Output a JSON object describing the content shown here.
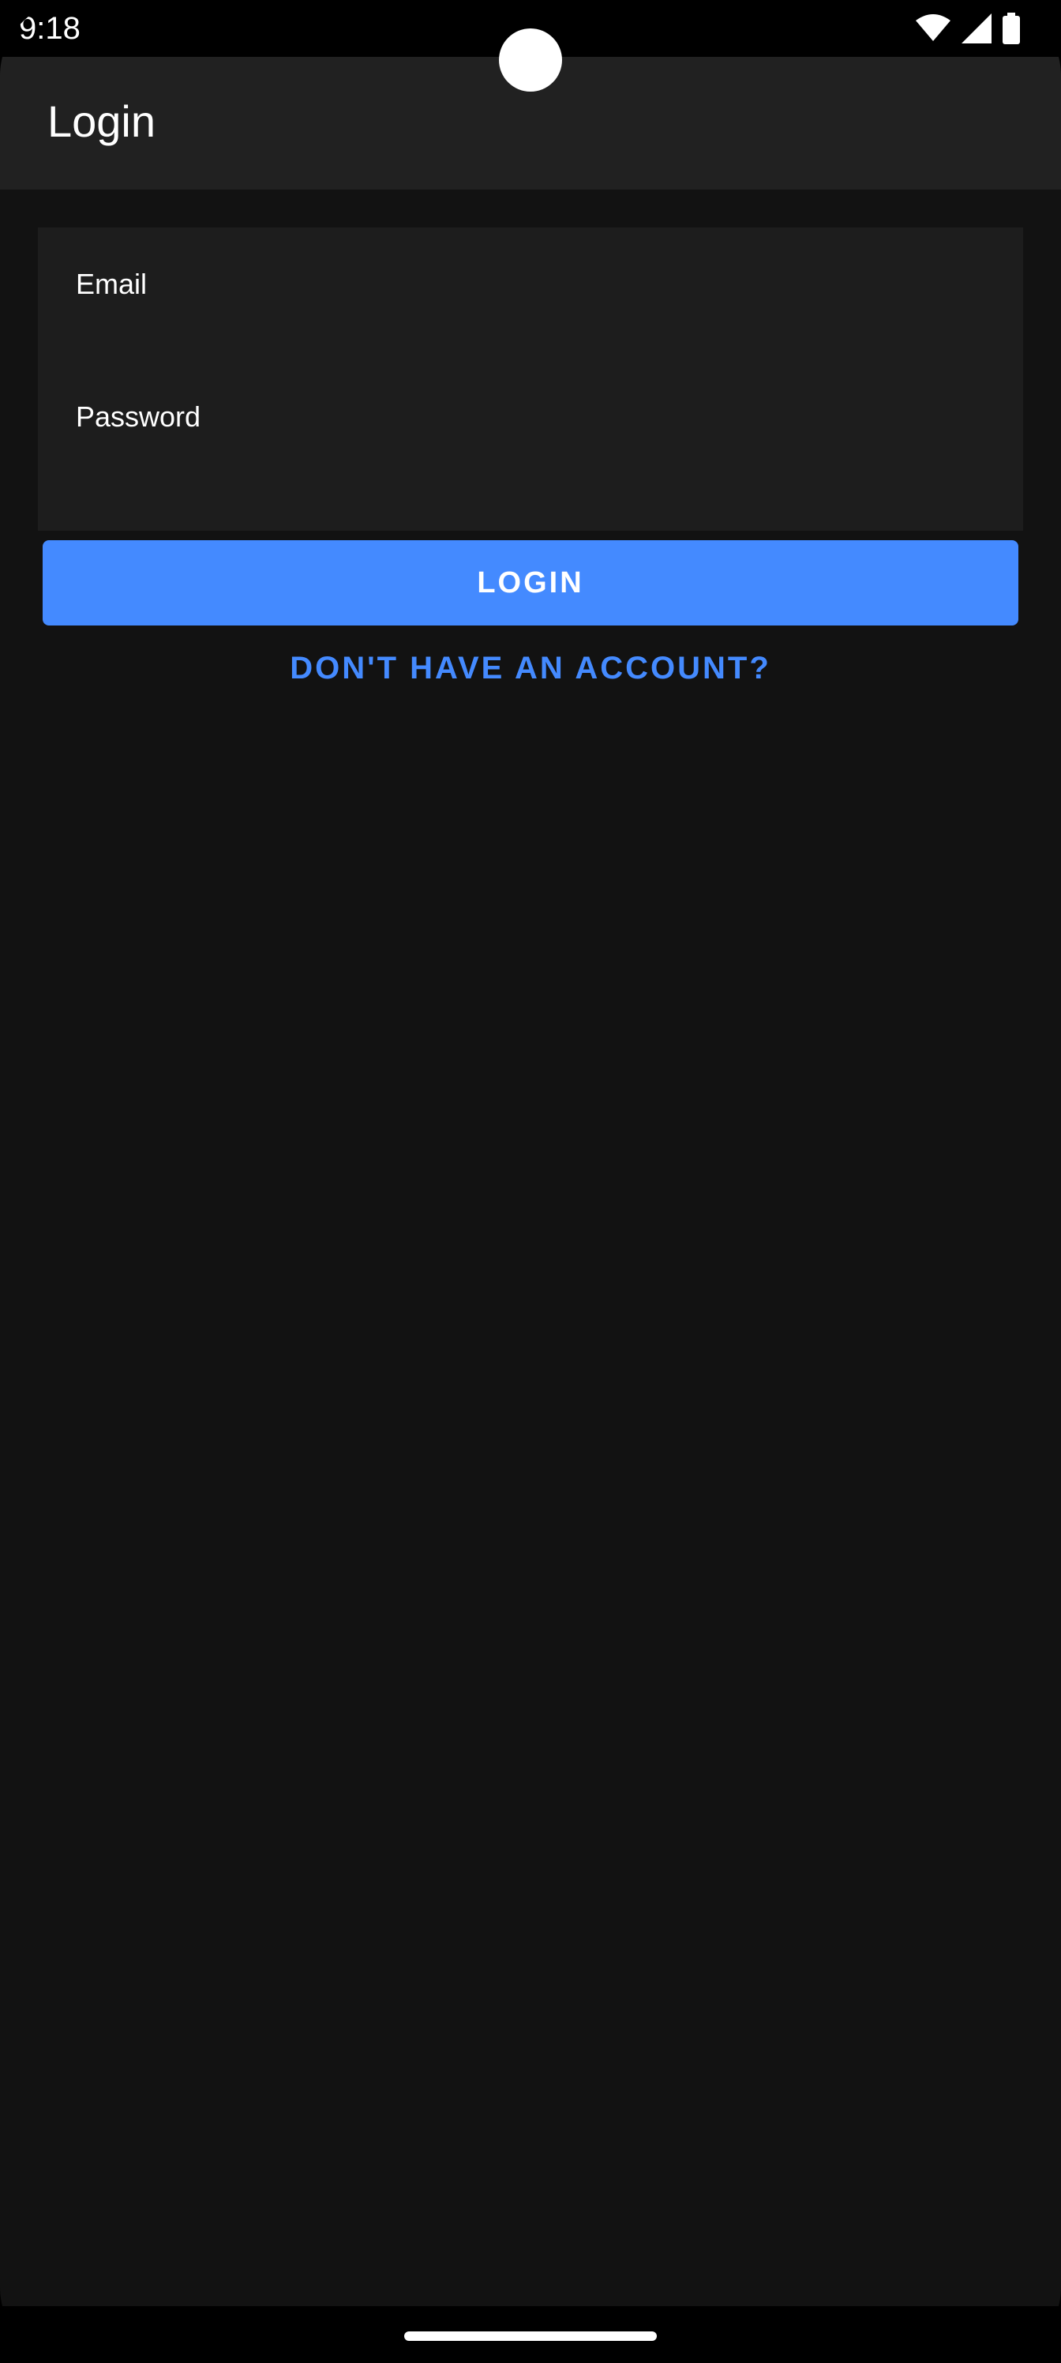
{
  "status_bar": {
    "time": "9:18",
    "icons": [
      "wifi-icon",
      "signal-icon",
      "battery-icon"
    ]
  },
  "app_bar": {
    "title": "Login"
  },
  "form": {
    "email_label": "Email",
    "email_value": "",
    "password_label": "Password",
    "password_value": "",
    "login_label": "LOGIN",
    "signup_label": "DON'T HAVE AN ACCOUNT?"
  },
  "colors": {
    "accent": "#448aff",
    "app_bar": "#212121",
    "background": "#121212",
    "field_background": "#1d1d1d"
  }
}
